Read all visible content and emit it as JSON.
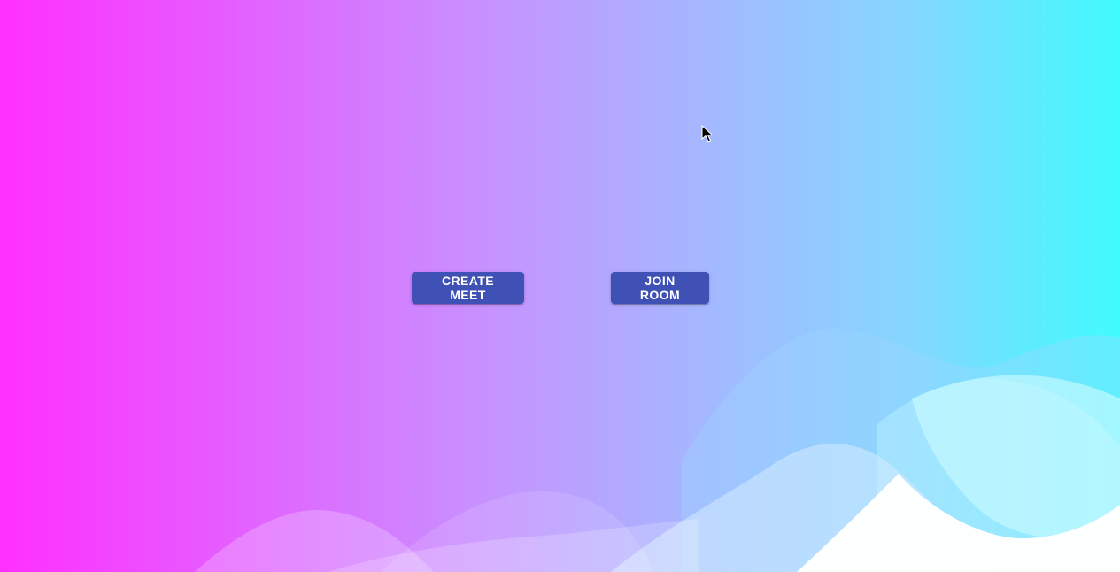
{
  "actions": {
    "create_meet_label": "CREATE MEET",
    "join_room_label": "JOIN ROOM"
  },
  "colors": {
    "gradient_left": "#ff2fff",
    "gradient_right": "#41fbff",
    "button_bg": "#3f51b5",
    "button_text": "#ffffff"
  },
  "icons": {
    "cursor": "mouse-pointer-icon"
  }
}
